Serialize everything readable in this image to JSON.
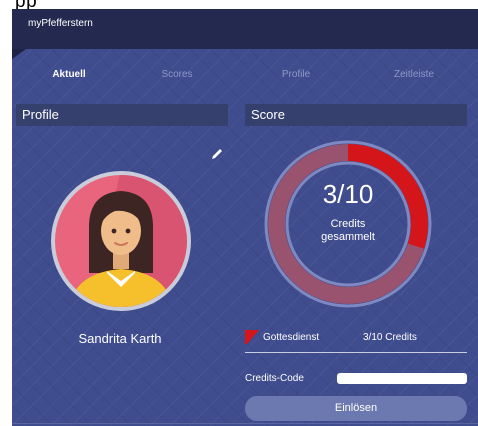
{
  "window": {
    "title": "pp"
  },
  "header": {
    "app_title": "myPfefferstern"
  },
  "tabs": [
    {
      "label": "Aktuell",
      "active": true
    },
    {
      "label": "Scores",
      "active": false
    },
    {
      "label": "Profile",
      "active": false
    },
    {
      "label": "Zeitleiste",
      "active": false
    }
  ],
  "profile": {
    "heading": "Profile",
    "user_name": "Sandrita Karth",
    "avatar_icon": "female-user-avatar-icon",
    "edit_icon": "pencil-icon"
  },
  "score": {
    "heading": "Score",
    "value": "3/10",
    "label_line1": "Credits",
    "label_line2": "gesammelt",
    "progress": 0.3,
    "progress_color": "#d4161b"
  },
  "categories": [
    {
      "name": "Gottesdienst",
      "value": "3/10 Credits",
      "icon": "red-flag-icon"
    }
  ],
  "redeem": {
    "code_label": "Credits-Code",
    "code_value": "",
    "button_label": "Einlösen"
  },
  "colors": {
    "header_bg": "#23294f",
    "panel_bg": "#3f4c8e",
    "accent_red": "#d4161b",
    "button_bg": "#6c78b0"
  }
}
